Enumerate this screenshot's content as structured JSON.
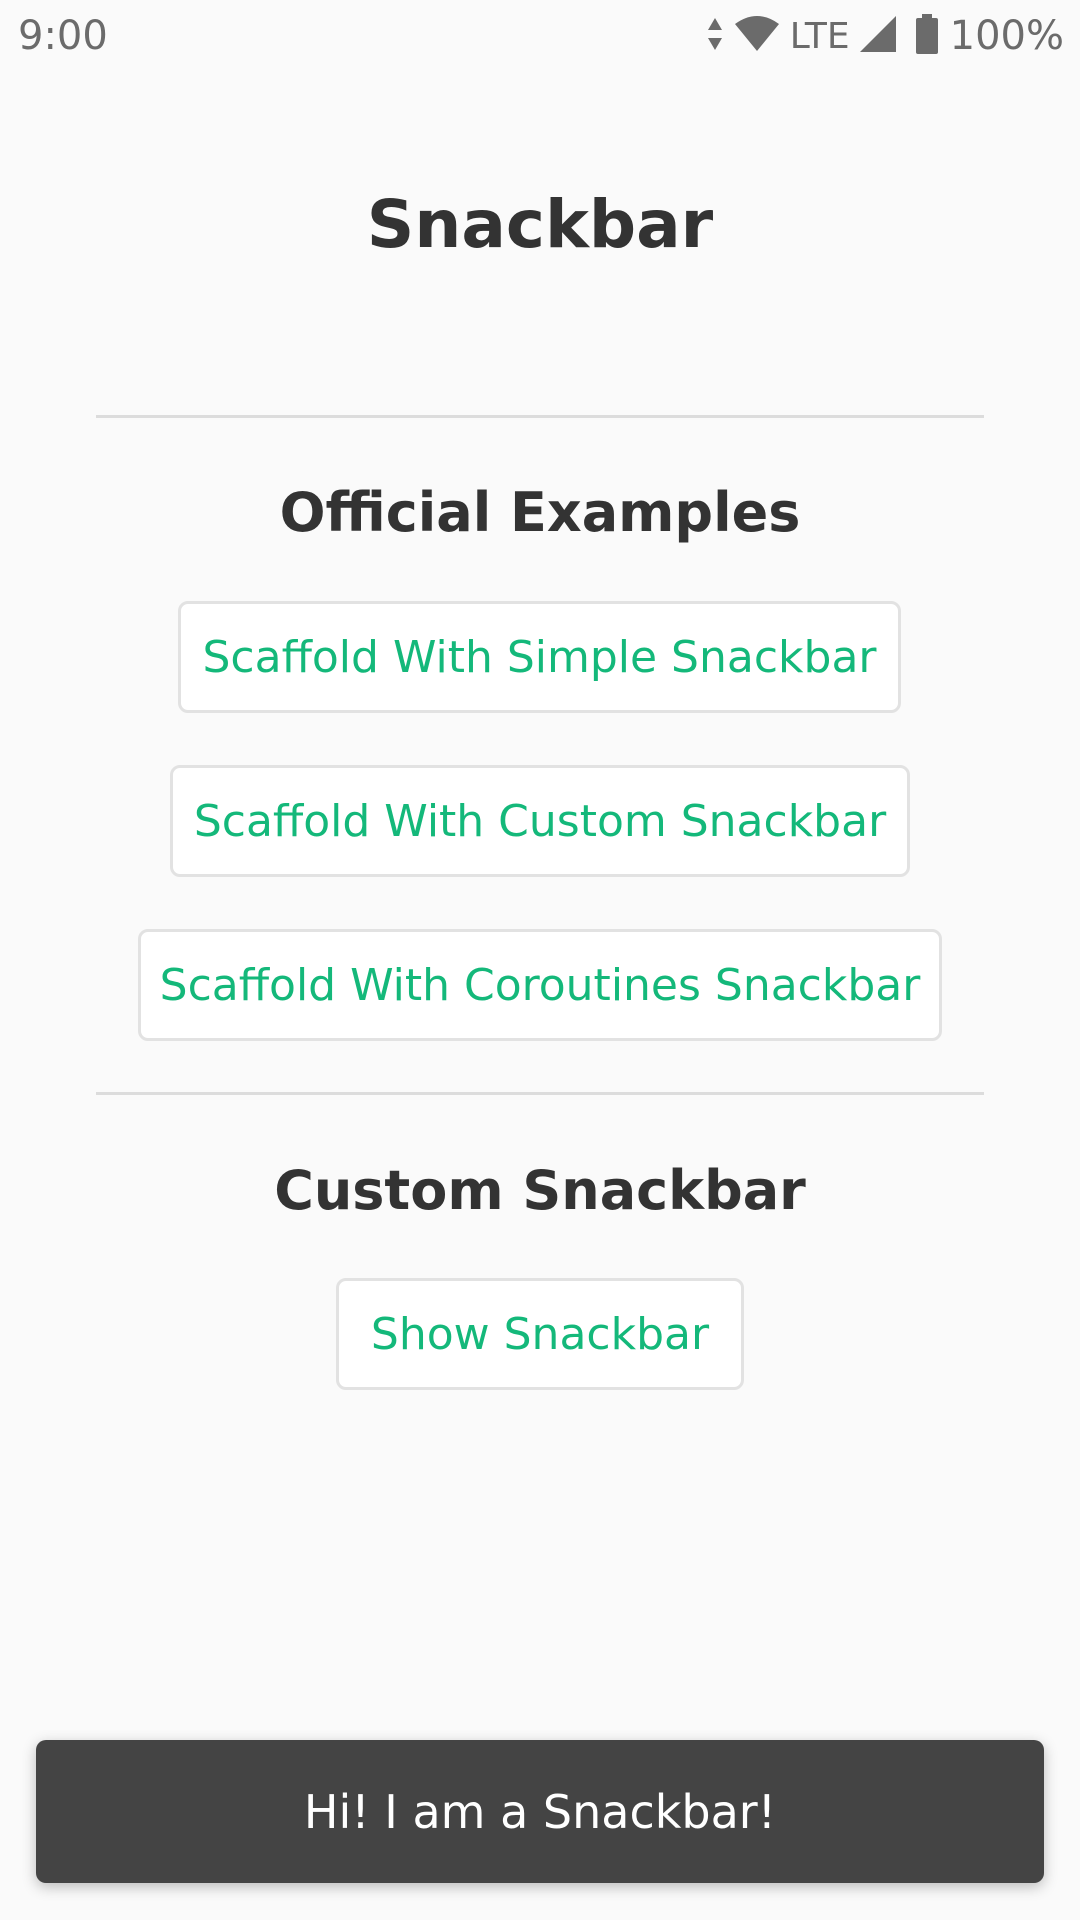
{
  "status_bar": {
    "time": "9:00",
    "network": "LTE",
    "battery": "100%",
    "icons": [
      "data-arrows-icon",
      "wifi-icon",
      "signal-icon",
      "battery-icon"
    ]
  },
  "title": "Snackbar",
  "sections": {
    "official": {
      "heading": "Official Examples",
      "buttons": [
        "Scaffold With Simple Snackbar",
        "Scaffold With Custom Snackbar",
        "Scaffold With Coroutines Snackbar"
      ]
    },
    "custom": {
      "heading": "Custom Snackbar",
      "buttons": [
        "Show Snackbar"
      ]
    }
  },
  "snackbar": {
    "message": "Hi! I am a Snackbar!"
  },
  "colors": {
    "accent": "#14b87a",
    "text": "#333333",
    "snackbar_bg": "#444444",
    "background": "#fafafa"
  }
}
